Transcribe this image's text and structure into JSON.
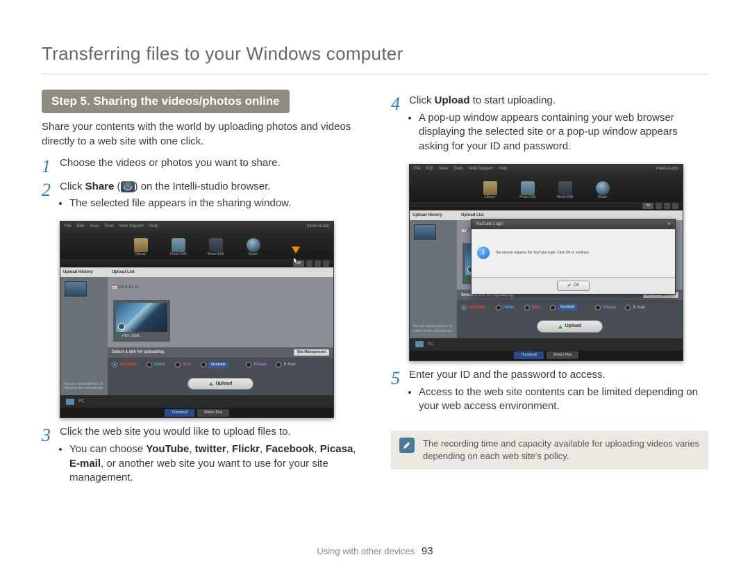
{
  "page_title": "Transferring files to your Windows computer",
  "section_banner": "Step 5. Sharing the videos/photos online",
  "intro": "Share your contents with the world by uploading photos and videos directly to a web site with one click.",
  "left": {
    "n1": "Choose the videos or photos you want to share.",
    "n2_a": "Click ",
    "n2_b": "Share",
    "n2_c": " (",
    "n2_d": ") on the Intelli-studio browser.",
    "n2_sub": "The selected file appears in the sharing window.",
    "n3": "Click the web site you would like to upload files to.",
    "n3_sub_a": "You can choose ",
    "n3_sub_b": "YouTube",
    "n3_sub_c": ", ",
    "n3_sub_d": "twitter",
    "n3_sub_e": ", ",
    "n3_sub_f": "Flickr",
    "n3_sub_g": ", ",
    "n3_sub_h": "Facebook",
    "n3_sub_i": ", ",
    "n3_sub_j": "Picasa",
    "n3_sub_k": ", ",
    "n3_sub_l": "E-mail",
    "n3_sub_m": ", or another web site you want to use for your site management."
  },
  "right": {
    "n4_a": "Click ",
    "n4_b": "Upload",
    "n4_c": " to start uploading.",
    "n4_sub": "A pop-up window appears containing your web browser displaying the selected site or a pop-up window appears asking for your ID and password.",
    "n5": "Enter your ID and the password to access.",
    "n5_sub": "Access to the web site contents can be limited depending on your web access environment.",
    "note": "The recording time and capacity available for uploading videos varies depending on each web site's policy."
  },
  "screenshot": {
    "menus": [
      "File",
      "Edit",
      "View",
      "Tools",
      "Web Support",
      "Help"
    ],
    "app_logo": "Intelli-studio",
    "icons": {
      "library": "Library",
      "photo": "Photo Edit",
      "movie": "Movie Edit",
      "share": "Share"
    },
    "toolbar": {
      "all": "All"
    },
    "sidebar_header": "Upload History",
    "main_header": "Upload List",
    "date": "2013-01-11",
    "thumb_caption": "HDV_0008...",
    "site_bar": "Select a site for uploading.",
    "site_mgmt": "Site Management",
    "sites": {
      "youtube": "YouTube",
      "twitter": "twitter",
      "flickr": "flickr",
      "facebook": "facebook",
      "picasa": "Picasa",
      "email": "E-mail"
    },
    "upload_btn": "Upload",
    "pc": "PC",
    "tabs": {
      "t1": "Thumbnail",
      "t2": "Motion Plus"
    },
    "modal_title": "YouTube Login",
    "modal_msg": "The service requires the YouTube login. Click OK to continue.",
    "ok": "OK",
    "info_glyph": "i"
  },
  "footer": {
    "section": "Using with other devices",
    "page": "93"
  }
}
